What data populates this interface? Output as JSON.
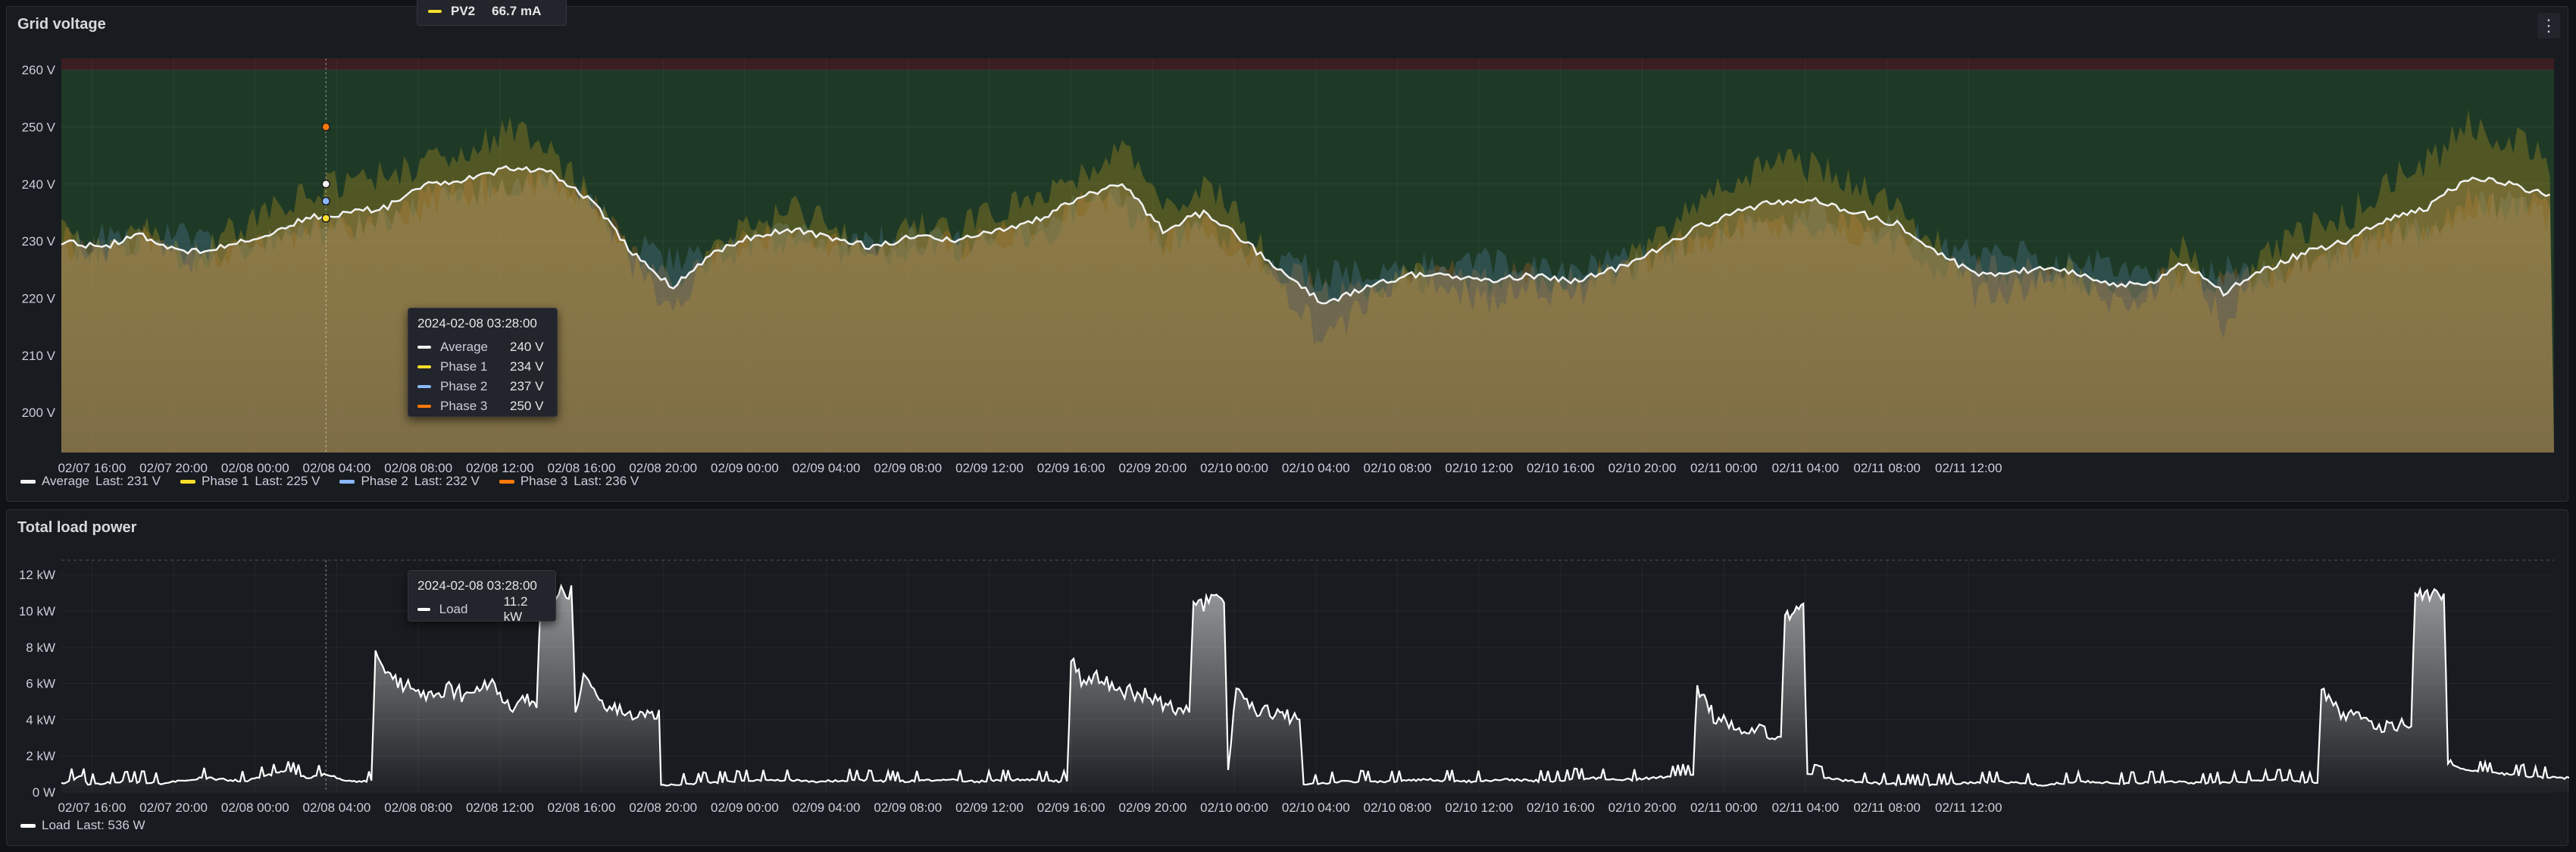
{
  "colors": {
    "average": "#f2f2f2",
    "phase1": "#fade2a",
    "phase2": "#8ab8ff",
    "phase3": "#ff780a",
    "load": "#ffffff",
    "ok_zone": "#1e3a26",
    "over_zone": "#3a1e22"
  },
  "top_tooltip": {
    "label": "PV2",
    "value": "66.7 mA"
  },
  "voltage_panel": {
    "title": "Grid voltage",
    "legend": [
      {
        "name": "Average",
        "last": "Last: 231 V",
        "color_key": "average"
      },
      {
        "name": "Phase 1",
        "last": "Last: 225 V",
        "color_key": "phase1"
      },
      {
        "name": "Phase 2",
        "last": "Last: 232 V",
        "color_key": "phase2"
      },
      {
        "name": "Phase 3",
        "last": "Last: 236 V",
        "color_key": "phase3"
      }
    ],
    "tooltip": {
      "time": "2024-02-08 03:28:00",
      "rows": [
        {
          "name": "Average",
          "value": "240 V",
          "color_key": "average"
        },
        {
          "name": "Phase 1",
          "value": "234 V",
          "color_key": "phase1"
        },
        {
          "name": "Phase 2",
          "value": "237 V",
          "color_key": "phase2"
        },
        {
          "name": "Phase 3",
          "value": "250 V",
          "color_key": "phase3"
        }
      ]
    }
  },
  "load_panel": {
    "title": "Total load power",
    "legend": [
      {
        "name": "Load",
        "last": "Last: 536 W",
        "color_key": "load"
      }
    ],
    "tooltip": {
      "time": "2024-02-08 03:28:00",
      "rows": [
        {
          "name": "Load",
          "value": "11.2 kW",
          "color_key": "load"
        }
      ]
    }
  },
  "chart_data": [
    {
      "type": "area",
      "title": "Grid voltage",
      "x_range": [
        "2024-02-07 14:30",
        "2024-02-11 16:40"
      ],
      "x_tick_labels": [
        "02/07 16:00",
        "02/07 20:00",
        "02/08 00:00",
        "02/08 04:00",
        "02/08 08:00",
        "02/08 12:00",
        "02/08 16:00",
        "02/08 20:00",
        "02/09 00:00",
        "02/09 04:00",
        "02/09 08:00",
        "02/09 12:00",
        "02/09 16:00",
        "02/09 20:00",
        "02/10 00:00",
        "02/10 04:00",
        "02/10 08:00",
        "02/10 12:00",
        "02/10 16:00",
        "02/10 20:00",
        "02/11 00:00",
        "02/11 04:00",
        "02/11 08:00",
        "02/11 12:00"
      ],
      "y_range": [
        193,
        262
      ],
      "y_ticks": [
        200,
        210,
        220,
        230,
        240,
        250,
        260
      ],
      "y_tick_labels": [
        "200 V",
        "210 V",
        "220 V",
        "230 V",
        "240 V",
        "250 V",
        "260 V"
      ],
      "threshold_zones": [
        {
          "from": 193,
          "to": 260,
          "color_key": "ok_zone"
        },
        {
          "from": 260,
          "to": 262,
          "color_key": "over_zone"
        }
      ],
      "x_hours": [
        0,
        2,
        4,
        6,
        8,
        10,
        12,
        14,
        16,
        18,
        20,
        22,
        24,
        26,
        28,
        30,
        32,
        34,
        36,
        38,
        40,
        42,
        44,
        46,
        48,
        50,
        52,
        54,
        56,
        58,
        60,
        62,
        64,
        66,
        68,
        70,
        72,
        74,
        76,
        78,
        80,
        82,
        84,
        86,
        88,
        90,
        92,
        94,
        96,
        98
      ],
      "series": [
        {
          "name": "Average",
          "color_key": "average",
          "values": [
            230,
            229,
            231,
            228,
            229,
            231,
            234,
            235,
            236,
            240,
            241,
            243,
            242,
            237,
            228,
            222,
            228,
            231,
            232,
            230,
            229,
            231,
            230,
            232,
            234,
            238,
            240,
            232,
            235,
            230,
            224,
            219,
            222,
            224,
            224,
            223,
            224,
            223,
            225,
            228,
            232,
            235,
            237,
            237,
            235,
            233,
            228,
            224,
            225,
            225,
            223,
            222,
            226,
            221,
            225,
            228,
            230,
            234,
            236,
            241,
            240,
            238,
            232,
            230,
            232,
            233
          ]
        },
        {
          "name": "Phase 1",
          "color_key": "phase1",
          "values": [
            232,
            228,
            233,
            226,
            231,
            235,
            238,
            240,
            242,
            244,
            246,
            250,
            245,
            238,
            226,
            218,
            230,
            233,
            235,
            232,
            230,
            233,
            232,
            235,
            238,
            242,
            246,
            236,
            240,
            233,
            222,
            212,
            220,
            224,
            222,
            220,
            223,
            220,
            224,
            230,
            236,
            240,
            244,
            243,
            240,
            236,
            230,
            220,
            222,
            226,
            220,
            218,
            230,
            215,
            228,
            232,
            234,
            240,
            244,
            250,
            248,
            244,
            234,
            224,
            226,
            225
          ]
        },
        {
          "name": "Phase 2",
          "color_key": "phase2",
          "values": [
            228,
            231,
            230,
            231,
            228,
            229,
            232,
            233,
            233,
            237,
            238,
            240,
            240,
            236,
            230,
            226,
            227,
            230,
            231,
            229,
            230,
            230,
            229,
            230,
            233,
            236,
            238,
            230,
            232,
            228,
            226,
            224,
            224,
            225,
            226,
            226,
            225,
            226,
            226,
            227,
            230,
            232,
            233,
            235,
            232,
            233,
            229,
            227,
            228,
            226,
            226,
            226,
            224,
            225,
            224,
            226,
            228,
            230,
            232,
            236,
            236,
            234,
            233,
            236,
            238,
            238
          ]
        },
        {
          "name": "Phase 3",
          "color_key": "phase3",
          "values": [
            230,
            228,
            230,
            227,
            228,
            229,
            232,
            232,
            233,
            239,
            239,
            239,
            241,
            237,
            228,
            222,
            227,
            230,
            230,
            229,
            227,
            230,
            229,
            231,
            231,
            236,
            236,
            230,
            233,
            229,
            224,
            221,
            222,
            223,
            224,
            223,
            224,
            223,
            225,
            227,
            230,
            233,
            234,
            233,
            233,
            230,
            225,
            225,
            225,
            223,
            223,
            222,
            224,
            223,
            223,
            226,
            228,
            232,
            232,
            237,
            236,
            236,
            229,
            230,
            232,
            236
          ]
        }
      ]
    },
    {
      "type": "area",
      "title": "Total load power",
      "x_range": [
        "2024-02-07 14:30",
        "2024-02-11 16:40"
      ],
      "x_tick_labels": [
        "02/07 16:00",
        "02/07 20:00",
        "02/08 00:00",
        "02/08 04:00",
        "02/08 08:00",
        "02/08 12:00",
        "02/08 16:00",
        "02/08 20:00",
        "02/09 00:00",
        "02/09 04:00",
        "02/09 08:00",
        "02/09 12:00",
        "02/09 16:00",
        "02/09 20:00",
        "02/10 00:00",
        "02/10 04:00",
        "02/10 08:00",
        "02/10 12:00",
        "02/10 16:00",
        "02/10 20:00",
        "02/11 00:00",
        "02/11 04:00",
        "02/11 08:00",
        "02/11 12:00"
      ],
      "y_range": [
        0,
        12.8
      ],
      "y_ticks": [
        0,
        2,
        4,
        6,
        8,
        10,
        12
      ],
      "y_tick_labels": [
        "0 W",
        "2 kW",
        "4 kW",
        "6 kW",
        "8 kW",
        "10 kW",
        "12 kW"
      ],
      "series": [
        {
          "name": "Load",
          "color_key": "load",
          "points_kw": [
            [
              0,
              0.5
            ],
            [
              1,
              0.9
            ],
            [
              1.3,
              0.4
            ],
            [
              3,
              0.6
            ],
            [
              5,
              0.5
            ],
            [
              7,
              0.8
            ],
            [
              9,
              0.6
            ],
            [
              11,
              1.2
            ],
            [
              12,
              0.8
            ],
            [
              13,
              1.0
            ],
            [
              14,
              0.6
            ],
            [
              15.2,
              0.6
            ],
            [
              15.4,
              7.8
            ],
            [
              16,
              6.4
            ],
            [
              17,
              5.8
            ],
            [
              18,
              5.4
            ],
            [
              19,
              5.8
            ],
            [
              20,
              5.2
            ],
            [
              21,
              6.0
            ],
            [
              22,
              4.8
            ],
            [
              22.5,
              5.0
            ],
            [
              23.3,
              5.0
            ],
            [
              23.5,
              10.8
            ],
            [
              24.5,
              11.2
            ],
            [
              25.0,
              11.0
            ],
            [
              25.2,
              4.8
            ],
            [
              25.6,
              6.2
            ],
            [
              26.5,
              5.0
            ],
            [
              27.5,
              4.6
            ],
            [
              28.5,
              4.2
            ],
            [
              29.3,
              4.2
            ],
            [
              29.4,
              0.4
            ],
            [
              31,
              0.5
            ],
            [
              33,
              0.6
            ],
            [
              35,
              0.7
            ],
            [
              37,
              0.6
            ],
            [
              39,
              0.7
            ],
            [
              41,
              0.6
            ],
            [
              43,
              0.7
            ],
            [
              45,
              0.6
            ],
            [
              47,
              0.7
            ],
            [
              49,
              0.6
            ],
            [
              49.3,
              0.6
            ],
            [
              49.5,
              7.6
            ],
            [
              50,
              6.0
            ],
            [
              51,
              6.4
            ],
            [
              52,
              5.6
            ],
            [
              53,
              5.4
            ],
            [
              54,
              4.8
            ],
            [
              55,
              4.6
            ],
            [
              55.3,
              4.6
            ],
            [
              55.5,
              10.2
            ],
            [
              56.5,
              10.6
            ],
            [
              57,
              10.4
            ],
            [
              57.2,
              1.2
            ],
            [
              57.6,
              5.8
            ],
            [
              58.5,
              4.6
            ],
            [
              59.5,
              4.4
            ],
            [
              60.7,
              4.0
            ],
            [
              60.9,
              0.4
            ],
            [
              63,
              0.6
            ],
            [
              65,
              0.6
            ],
            [
              67,
              0.7
            ],
            [
              69,
              0.6
            ],
            [
              71,
              0.7
            ],
            [
              73,
              0.6
            ],
            [
              75,
              0.8
            ],
            [
              77,
              0.7
            ],
            [
              79,
              0.9
            ],
            [
              80,
              1.0
            ],
            [
              80.2,
              5.8
            ],
            [
              81,
              4.2
            ],
            [
              82,
              3.6
            ],
            [
              83,
              3.6
            ],
            [
              84,
              3.2
            ],
            [
              84.3,
              3.4
            ],
            [
              84.5,
              9.8
            ],
            [
              85.4,
              10.0
            ],
            [
              85.6,
              1.0
            ],
            [
              87,
              0.7
            ],
            [
              89,
              0.5
            ],
            [
              91,
              0.4
            ],
            [
              93,
              0.5
            ],
            [
              95,
              0.6
            ],
            [
              97,
              0.4
            ],
            [
              99,
              0.6
            ],
            [
              101,
              0.5
            ],
            [
              103,
              0.6
            ],
            [
              105,
              0.5
            ],
            [
              107,
              0.6
            ],
            [
              109,
              0.7
            ],
            [
              110.6,
              0.5
            ],
            [
              110.8,
              5.6
            ],
            [
              111.5,
              4.6
            ],
            [
              112.5,
              4.0
            ],
            [
              113.5,
              3.8
            ],
            [
              114.5,
              3.6
            ],
            [
              115.2,
              3.6
            ],
            [
              115.4,
              10.8
            ],
            [
              116.8,
              10.8
            ],
            [
              117,
              1.6
            ],
            [
              118,
              1.2
            ],
            [
              120,
              1.0
            ],
            [
              122,
              0.8
            ],
            [
              124,
              0.8
            ],
            [
              126,
              0.7
            ],
            [
              128,
              0.8
            ],
            [
              130,
              0.7
            ],
            [
              132,
              0.6
            ],
            [
              134,
              0.7
            ],
            [
              136,
              0.5
            ],
            [
              137,
              0.8
            ],
            [
              138,
              0.5
            ]
          ]
        }
      ]
    }
  ]
}
